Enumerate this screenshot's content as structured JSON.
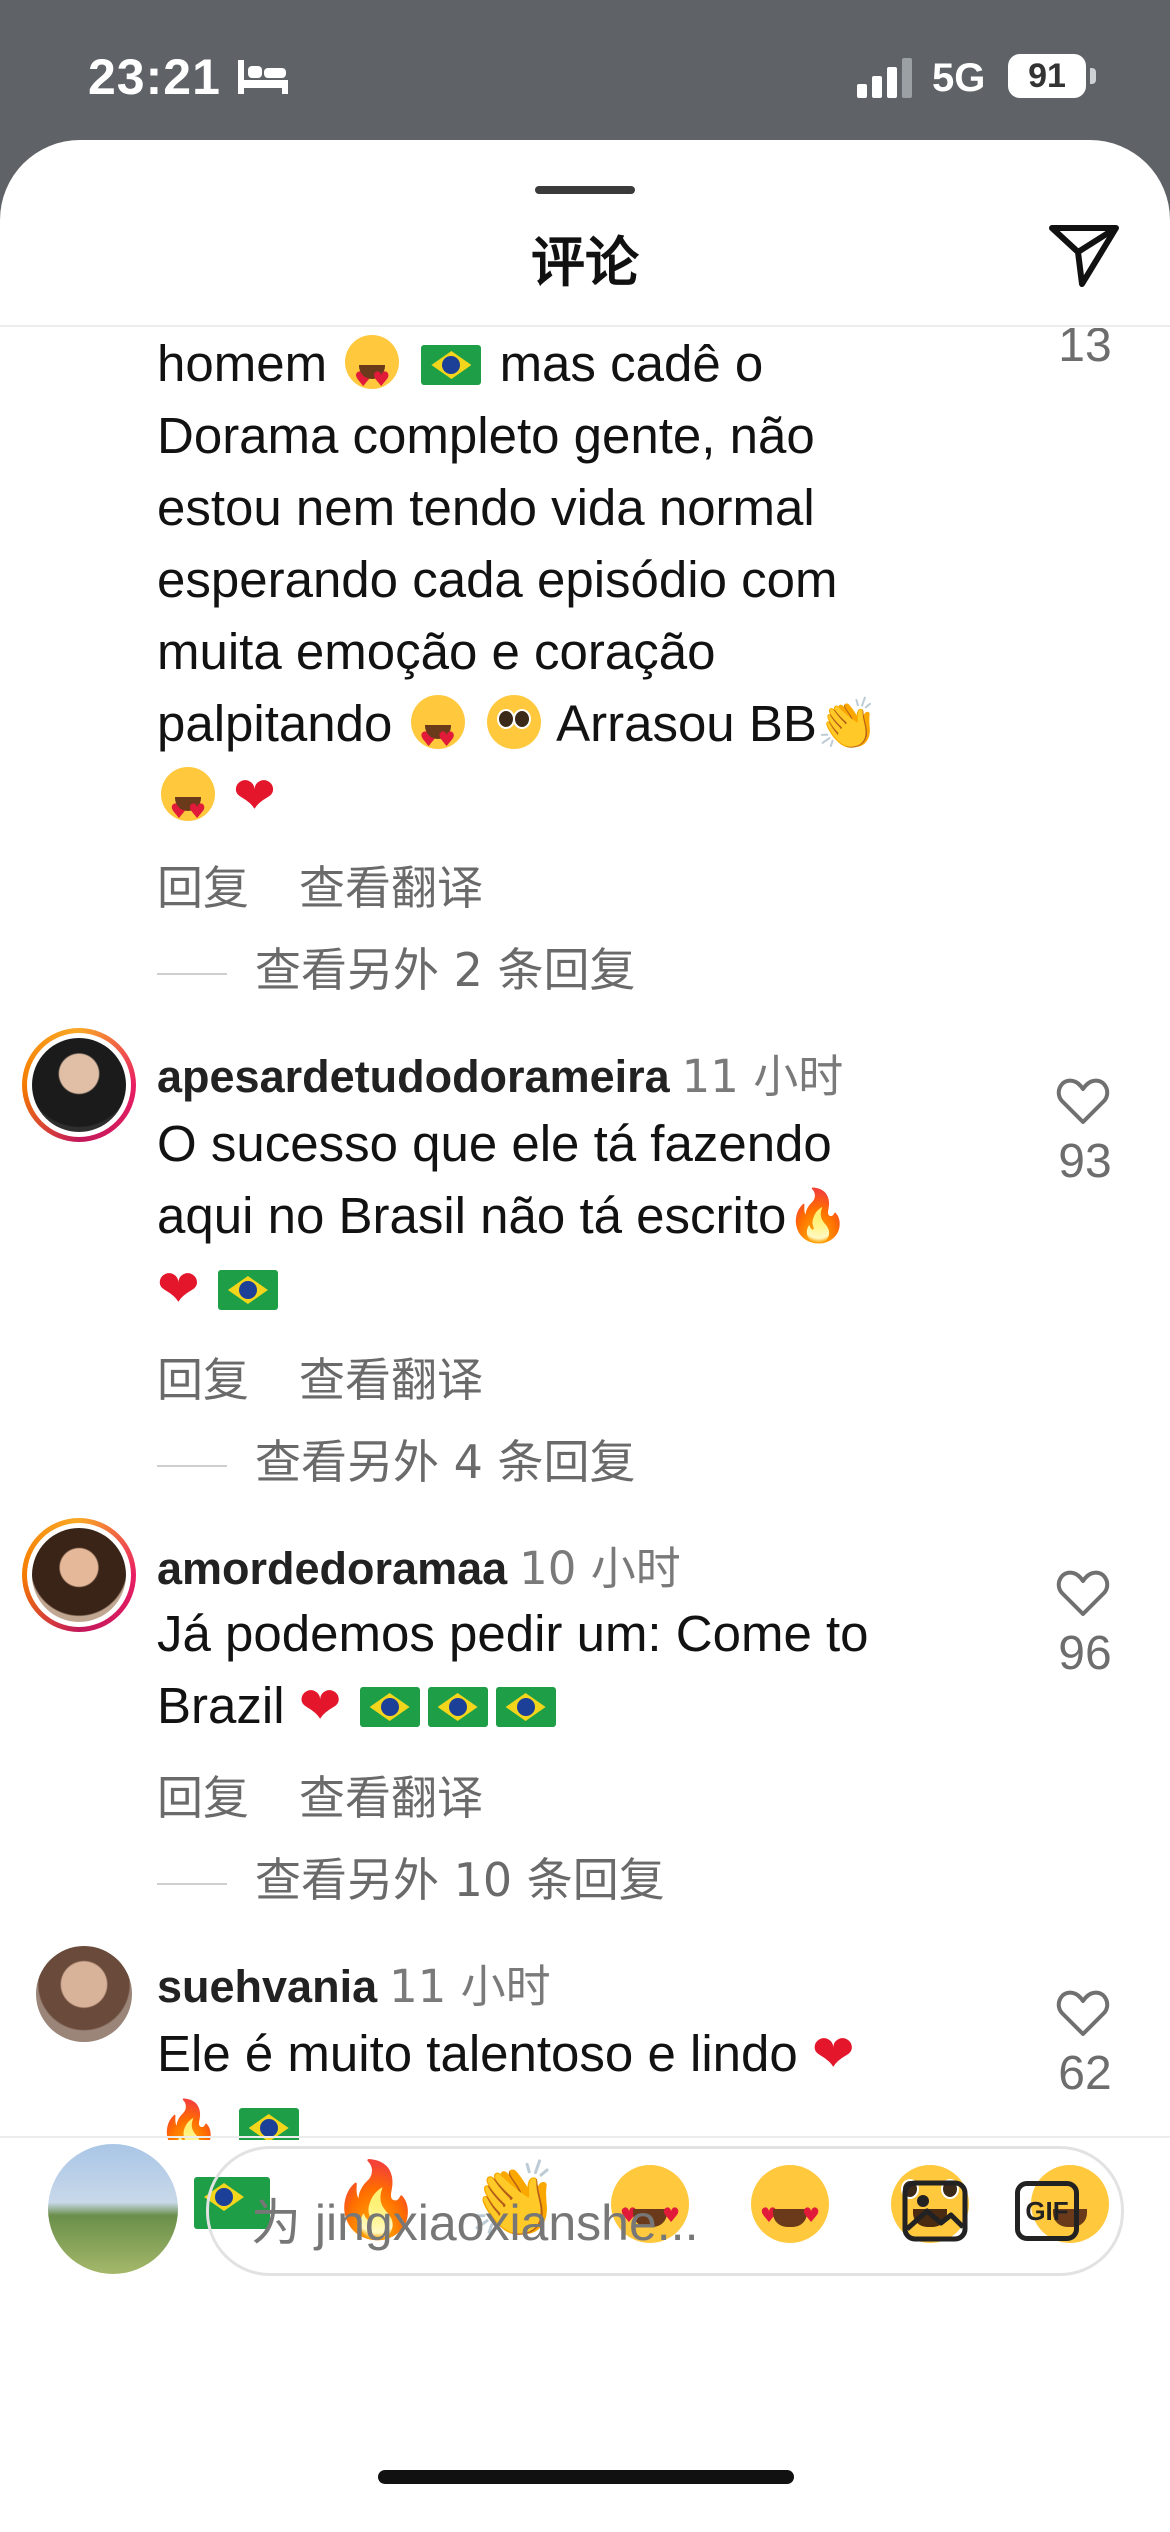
{
  "status_bar": {
    "time": "23:21",
    "network": "5G",
    "battery": "91"
  },
  "sheet": {
    "title": "评论"
  },
  "actions": {
    "reply": "回复",
    "translate": "查看翻译"
  },
  "comments": [
    {
      "partial_top": true,
      "lines": [
        "homem",
        "mas cadê o",
        "Dorama completo gente, não",
        "estou nem tendo vida normal",
        "esperando cada episódio com",
        "muita emoção e coração",
        "palpitando",
        "Arrasou BB"
      ],
      "likes": "13",
      "more_replies": "查看另外 2 条回复"
    },
    {
      "username": "apesardetudodorameira",
      "time": "11 小时",
      "lines": [
        "O sucesso que ele tá fazendo",
        "aqui no Brasil não tá escrito"
      ],
      "likes": "93",
      "more_replies": "查看另外 4 条回复"
    },
    {
      "username": "amordedoramaa",
      "time": "10 小时",
      "lines": [
        "Já podemos pedir um: Come to",
        "Brazil"
      ],
      "likes": "96",
      "more_replies": "查看另外 10 条回复"
    },
    {
      "username": "suehvania",
      "time": "11 小时",
      "lines": [
        "Ele é muito talentoso e lindo"
      ],
      "likes": "62"
    }
  ],
  "emoji_bar": [
    "red-heart",
    "brazil-flag",
    "fire",
    "clapping-hands",
    "smiling-face-with-hearts",
    "heart-eyes",
    "crying-face",
    "tears-of-joy"
  ],
  "input": {
    "placeholder": "为 jingxiaoxianshe..."
  },
  "colors": {
    "heart": "#e3162b",
    "muted": "#6a6a6a",
    "ring": "#e91e63"
  }
}
